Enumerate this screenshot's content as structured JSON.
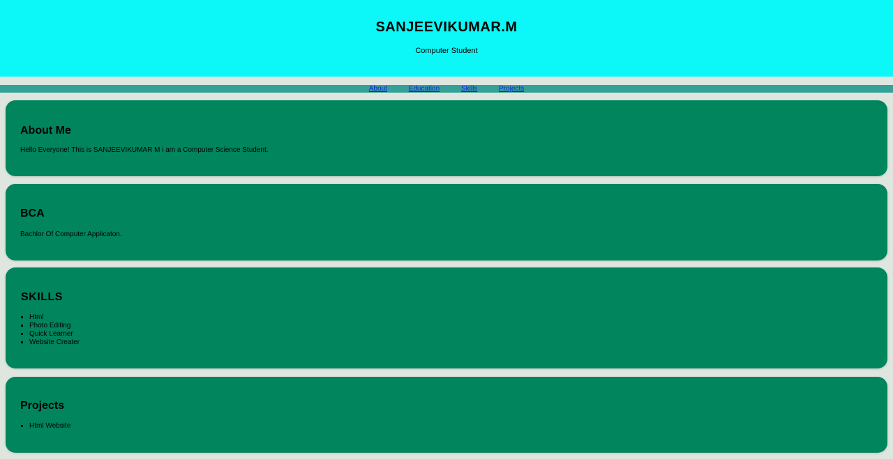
{
  "header": {
    "name": "SANJEEVIKUMAR.M",
    "role": "Computer Student"
  },
  "nav": {
    "items": [
      "About",
      "Education",
      "Skills",
      "Projects"
    ]
  },
  "about": {
    "title": "About Me",
    "text": "Hello Everyone! This is SANJEEVIKUMAR M i am a Computer Science Student."
  },
  "education": {
    "title": "BCA",
    "text": "Bachlor Of Computer Applicaton."
  },
  "skills": {
    "title": "SKILLS",
    "items": [
      "Html",
      "Photo Editing",
      "Quick Learner",
      "Website Creater"
    ]
  },
  "projects": {
    "title": "Projects",
    "items": [
      "Html Website"
    ]
  },
  "colors": {
    "header_bg": "#0cf8f8",
    "nav_bg": "#34a198",
    "card_bg": "#00855c",
    "page_bg": "#dfe6df",
    "link": "#1a1aee"
  }
}
